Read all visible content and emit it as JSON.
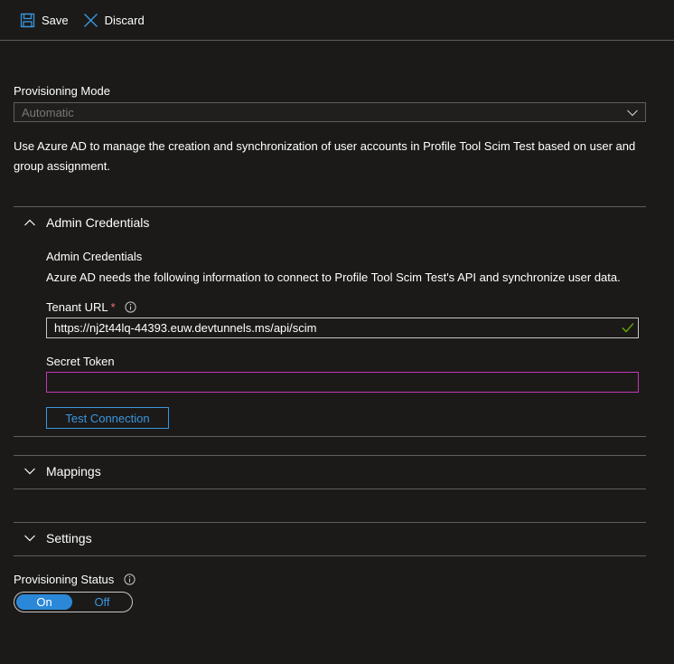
{
  "toolbar": {
    "save_label": "Save",
    "discard_label": "Discard"
  },
  "provisioning_mode": {
    "label": "Provisioning Mode",
    "selected_value": "Automatic"
  },
  "description": "Use Azure AD to manage the creation and synchronization of user accounts in Profile Tool Scim Test based on user and group assignment.",
  "admin_credentials": {
    "section_title": "Admin Credentials",
    "heading": "Admin Credentials",
    "subtext": "Azure AD needs the following information to connect to Profile Tool Scim Test's API and synchronize user data.",
    "tenant_url_label": "Tenant URL",
    "required_marker": "*",
    "tenant_url_value": "https://nj2t44lq-44393.euw.devtunnels.ms/api/scim",
    "secret_token_label": "Secret Token",
    "secret_token_value": "",
    "test_connection_label": "Test Connection"
  },
  "mappings": {
    "section_title": "Mappings"
  },
  "settings": {
    "section_title": "Settings"
  },
  "provisioning_status": {
    "label": "Provisioning Status",
    "on_label": "On",
    "off_label": "Off",
    "selected": "On"
  },
  "colors": {
    "background": "#1b1a19",
    "accent": "#2b88d8",
    "link_blue": "#3a96dd",
    "focus_border": "#c239b3",
    "valid_check": "#6bb700",
    "required": "#f1707b"
  }
}
